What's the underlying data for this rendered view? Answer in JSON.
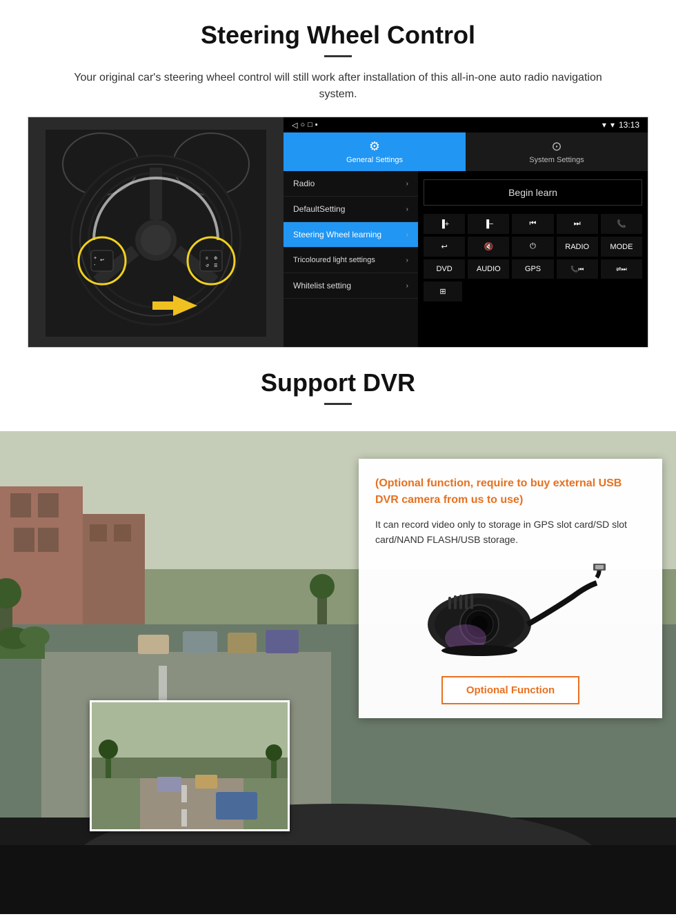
{
  "steering": {
    "title": "Steering Wheel Control",
    "subtitle": "Your original car's steering wheel control will still work after installation of this all-in-one auto radio navigation system.",
    "screen": {
      "time": "13:13",
      "tabs": [
        {
          "label": "General Settings",
          "active": true
        },
        {
          "label": "System Settings",
          "active": false
        }
      ],
      "menu_items": [
        {
          "label": "Radio",
          "active": false
        },
        {
          "label": "DefaultSetting",
          "active": false
        },
        {
          "label": "Steering Wheel learning",
          "active": true
        },
        {
          "label": "Tricoloured light settings",
          "active": false
        },
        {
          "label": "Whitelist setting",
          "active": false
        }
      ],
      "begin_learn": "Begin learn",
      "control_buttons": [
        [
          "vol+",
          "vol-",
          "⏮",
          "⏭",
          "📞"
        ],
        [
          "↩",
          "🔇",
          "⏻",
          "RADIO",
          "MODE"
        ],
        [
          "DVD",
          "AUDIO",
          "GPS",
          "⏮📞",
          "🔀⏭"
        ]
      ]
    }
  },
  "dvr": {
    "title": "Support DVR",
    "optional_text": "(Optional function, require to buy external USB DVR camera from us to use)",
    "desc_text": "It can record video only to storage in GPS slot card/SD slot card/NAND FLASH/USB storage.",
    "optional_function_btn": "Optional Function"
  }
}
